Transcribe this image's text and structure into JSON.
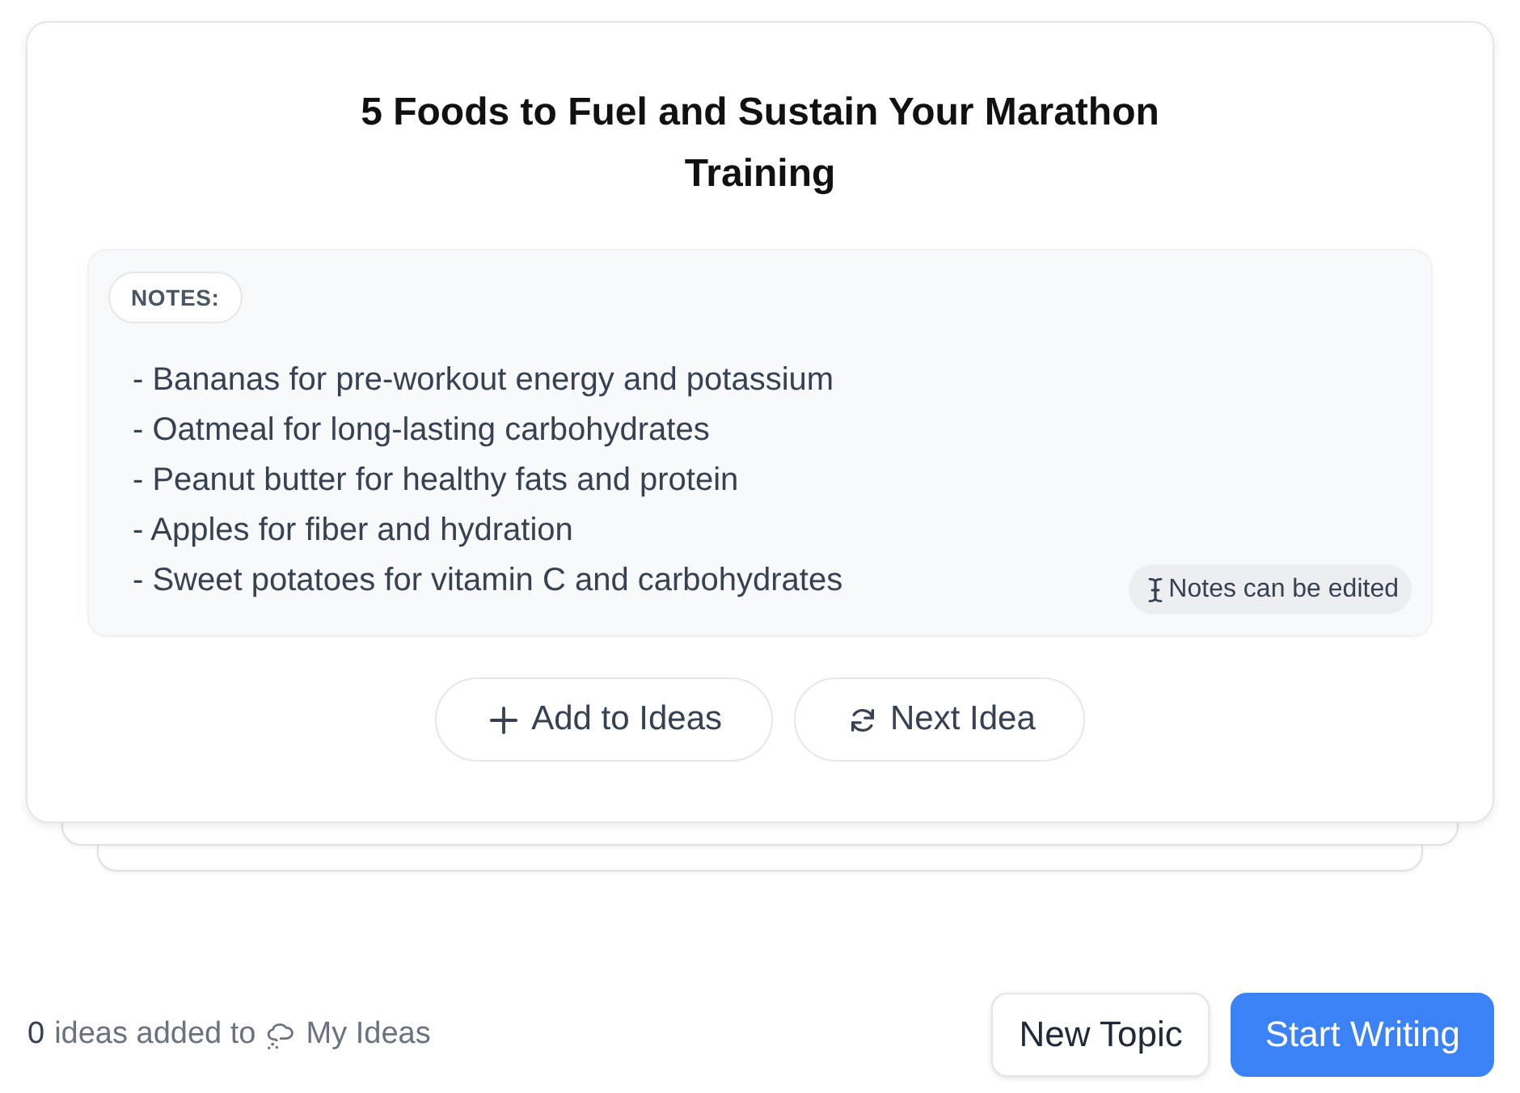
{
  "card": {
    "title": "5 Foods to Fuel and Sustain Your Marathon Training",
    "notes": {
      "label": "NOTES:",
      "lines": [
        "- Bananas for pre-workout energy and potassium",
        "- Oatmeal for long-lasting carbohydrates",
        "- Peanut butter for healthy fats and protein",
        "- Apples for fiber and hydration",
        "- Sweet potatoes for vitamin C and carbohydrates"
      ],
      "hint": "Notes can be edited"
    },
    "actions": [
      {
        "kind": "add",
        "label": "Add to Ideas"
      },
      {
        "kind": "next",
        "label": "Next Idea"
      }
    ]
  },
  "footer": {
    "count": "0",
    "text": "ideas added to",
    "link": "My Ideas",
    "buttons": [
      {
        "kind": "secondary",
        "label": "New Topic"
      },
      {
        "kind": "primary",
        "label": "Start Writing"
      }
    ]
  }
}
